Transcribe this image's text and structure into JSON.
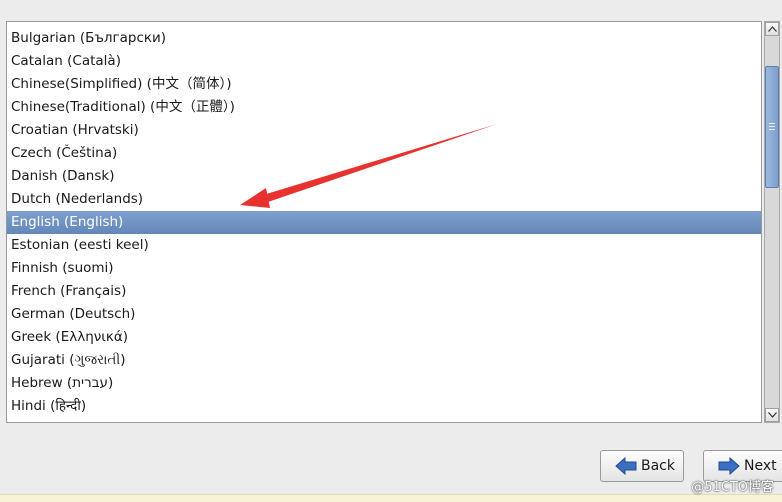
{
  "languages": [
    {
      "label": "Bulgarian (Български)"
    },
    {
      "label": "Catalan (Català)"
    },
    {
      "label": "Chinese(Simplified) (中文（简体）)"
    },
    {
      "label": "Chinese(Traditional) (中文（正體）)"
    },
    {
      "label": "Croatian (Hrvatski)"
    },
    {
      "label": "Czech (Čeština)"
    },
    {
      "label": "Danish (Dansk)"
    },
    {
      "label": "Dutch (Nederlands)"
    },
    {
      "label": "English (English)"
    },
    {
      "label": "Estonian (eesti keel)"
    },
    {
      "label": "Finnish (suomi)"
    },
    {
      "label": "French (Français)"
    },
    {
      "label": "German (Deutsch)"
    },
    {
      "label": "Greek (Ελληνικά)"
    },
    {
      "label": "Gujarati (ગુજરાતી)"
    },
    {
      "label": "Hebrew (עברית)"
    },
    {
      "label": "Hindi (हिन्दी)"
    }
  ],
  "selected_language": "English (English)",
  "buttons": {
    "back_label": "Back",
    "next_label": "Next"
  },
  "watermark": "@51CTO博客",
  "icons": {
    "back": "back-arrow-icon",
    "next": "next-arrow-icon",
    "scroll_up": "chevron-up-icon",
    "scroll_down": "chevron-down-icon"
  },
  "colors": {
    "selection": "#6f93c2",
    "annotation_arrow": "#e8322f",
    "button_arrow": "#3a6fc2"
  }
}
